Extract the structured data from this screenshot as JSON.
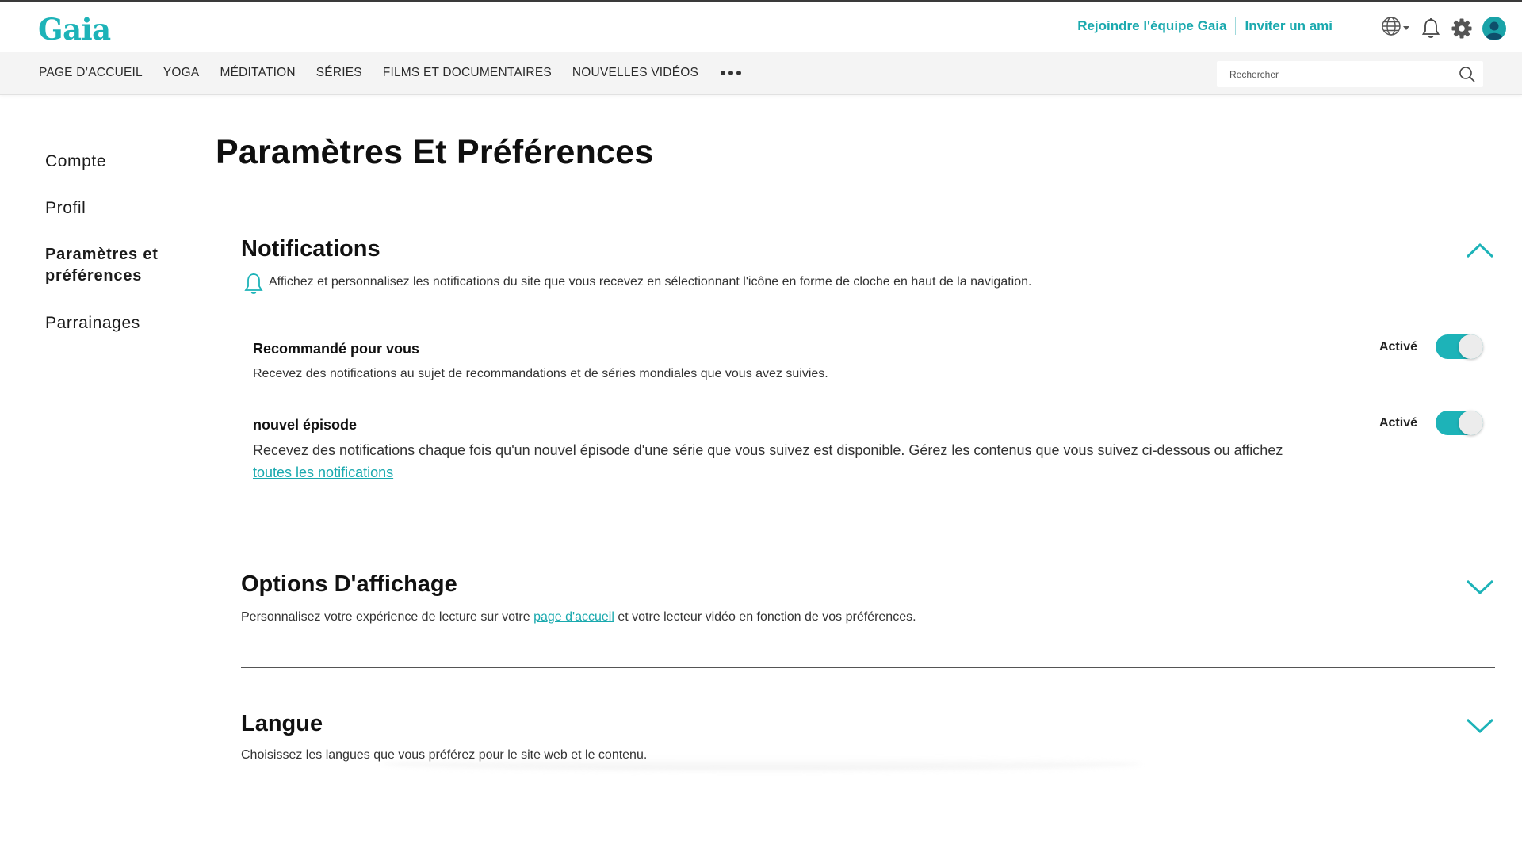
{
  "header": {
    "logo": "Gaia",
    "join_link": "Rejoindre l'équipe Gaia",
    "invite_link": "Inviter un ami",
    "icons": [
      "globe-icon",
      "caret-down-icon",
      "bell-icon",
      "gear-icon",
      "avatar"
    ]
  },
  "nav": {
    "items": [
      "PAGE D’ACCUEIL",
      "YOGA",
      "MÉDITATION",
      "SÉRIES",
      "FILMS ET DOCUMENTAIRES",
      "NOUVELLES VIDÉOS"
    ],
    "more_icon": "more-dots-icon",
    "search_placeholder": "Rechercher"
  },
  "sidebar": {
    "items": [
      {
        "label": "Compte",
        "active": false
      },
      {
        "label": "Profil",
        "active": false
      },
      {
        "label": "Paramètres et préférences",
        "active": true
      },
      {
        "label": "Parrainages",
        "active": false
      }
    ]
  },
  "page": {
    "title": "Paramètres Et Préférences"
  },
  "sections": {
    "notifications": {
      "title": "Notifications",
      "description": "Affichez et personnalisez les notifications du site que vous recevez en sélectionnant l'icône en forme de cloche en haut de la navigation.",
      "expanded": true,
      "prefs": [
        {
          "title": "Recommandé pour vous",
          "description": "Recevez des notifications au sujet de recommandations et de séries mondiales que vous avez suivies.",
          "toggle_label": "Activé",
          "enabled": true
        },
        {
          "title": "nouvel épisode",
          "description": "Recevez des notifications chaque fois qu'un nouvel épisode d'une série que vous suivez est disponible. Gérez les contenus que vous suivez ci-dessous ou affichez ",
          "link": "toutes les notifications",
          "toggle_label": "Activé",
          "enabled": true
        }
      ]
    },
    "display": {
      "title": "Options D'affichage",
      "desc_before": "Personnalisez votre expérience de lecture sur votre ",
      "desc_link": "page d'accueil",
      "desc_after": " et votre lecteur vidéo en fonction de vos préférences.",
      "expanded": false
    },
    "language": {
      "title": "Langue",
      "description": "Choisissez les langues que vous préférez pour le site web et le contenu.",
      "expanded": false
    }
  },
  "colors": {
    "accent": "#1db3b8",
    "text": "#111111",
    "nav_bg": "#f4f4f4",
    "toggle_knob": "#ececec"
  }
}
